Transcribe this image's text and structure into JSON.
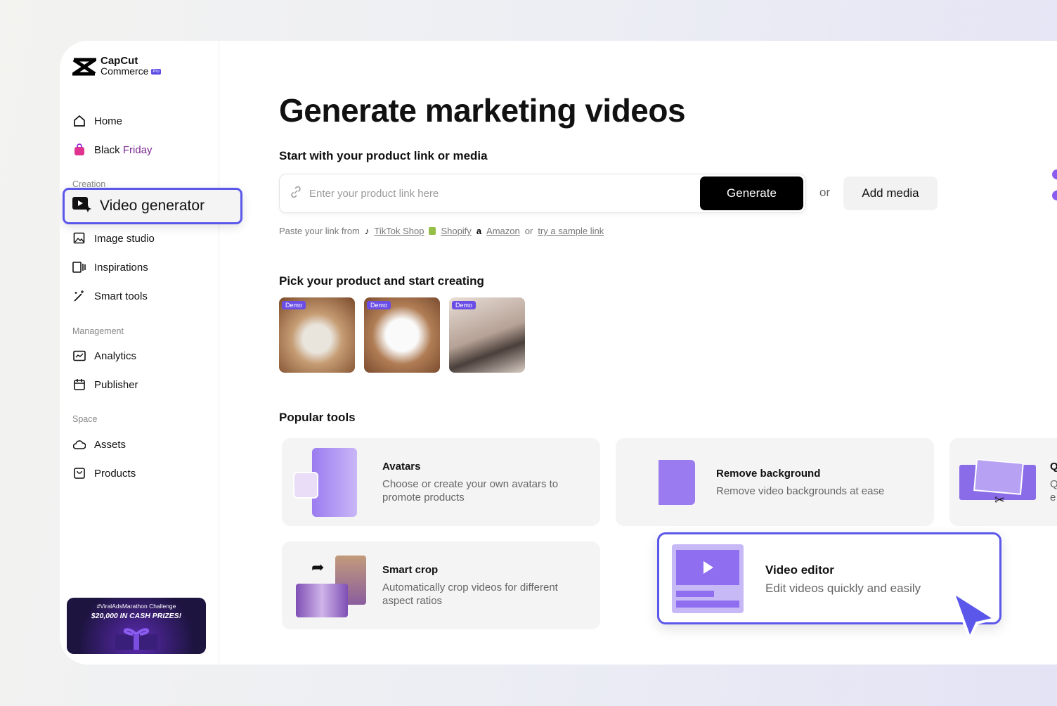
{
  "brand": {
    "name": "CapCut",
    "sub": "Commerce",
    "badge": "Pro"
  },
  "sidebar": {
    "items": [
      {
        "label": "Home"
      },
      {
        "label_a": "Black",
        "label_b": "Friday"
      }
    ],
    "sections": {
      "creation": "Creation",
      "management": "Management",
      "space": "Space"
    },
    "creation": [
      {
        "label": "Video generator"
      },
      {
        "label": "Image studio"
      },
      {
        "label": "Inspirations"
      },
      {
        "label": "Smart tools"
      }
    ],
    "management": [
      {
        "label": "Analytics"
      },
      {
        "label": "Publisher"
      }
    ],
    "space": [
      {
        "label": "Assets"
      },
      {
        "label": "Products"
      }
    ],
    "banner": {
      "line1": "#ViralAdsMarathon Challenge",
      "line2": "$20,000 IN CASH PRIZES!"
    }
  },
  "main": {
    "title": "Generate marketing videos",
    "start_heading": "Start with your product link or media",
    "input_placeholder": "Enter your product link here",
    "generate": "Generate",
    "or": "or",
    "add_media": "Add media",
    "paste": {
      "prefix": "Paste your link from",
      "tiktok": "TikTok Shop",
      "shopify": "Shopify",
      "amazon": "Amazon",
      "or": "or",
      "sample": "try a sample link"
    },
    "pick_heading": "Pick your product and start creating",
    "demo_label": "Demo",
    "popular_heading": "Popular tools",
    "tools": [
      {
        "title": "Avatars",
        "desc": "Choose or create your own avatars to promote products"
      },
      {
        "title": "Remove background",
        "desc": "Remove video backgrounds at ease"
      },
      {
        "title": "Q",
        "desc": "Q\ne"
      },
      {
        "title": "Smart crop",
        "desc": "Automatically crop videos for different aspect ratios"
      },
      {
        "title": "Video editor",
        "desc": "Edit videos quickly and easily"
      }
    ]
  },
  "colors": {
    "accent": "#5b57ea",
    "badge": "#6a4de6",
    "tool_purple": "#9b7cf0"
  }
}
